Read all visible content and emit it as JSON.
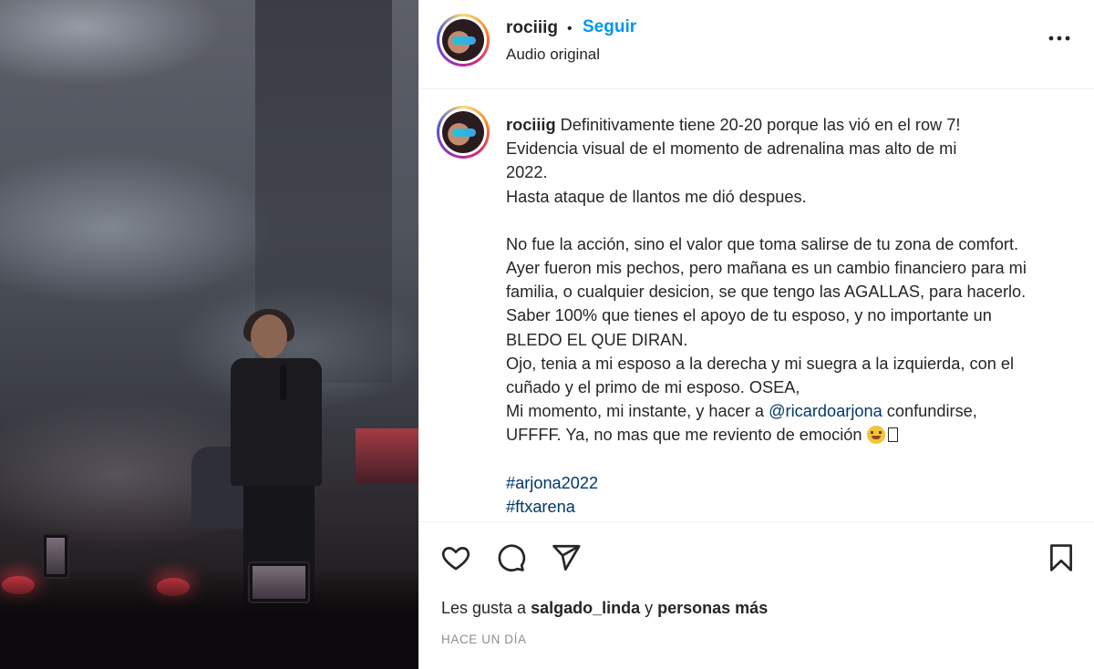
{
  "post": {
    "username": "rociiig",
    "dot": "•",
    "follow_label": "Seguir",
    "audio_label": "Audio original",
    "more_icon": "more-options-icon"
  },
  "caption": {
    "username": "rociiig",
    "line1": "Definitivamente tiene 20-20 porque las vió en el row 7!",
    "line2": "Evidencia visual de el momento de adrenalina mas alto de mi",
    "line3": "2022.",
    "line4": "Hasta ataque de llantos me dió despues.",
    "para2": "No fue la acción, sino el valor que toma salirse de tu zona de comfort. Ayer fueron mis pechos, pero mañana es un cambio financiero para mi familia, o cualquier desicion, se que tengo las AGALLAS, para hacerlo. Saber 100% que tienes el apoyo de tu esposo, y no importante un BLEDO EL QUE DIRAN.",
    "para3": "Ojo, tenia a mi esposo a la derecha y mi suegra a la izquierda, con el cuñado y el primo de mi esposo. OSEA,",
    "para4_pre": "Mi momento, mi instante, y hacer a ",
    "mention": "@ricardoarjona",
    "para4_post": " confundirse,",
    "para5": "UFFFF. Ya, no mas que me reviento de emoción ",
    "hashtag1": "#arjona2022",
    "hashtag2": "#ftxarena"
  },
  "actions": {
    "like_icon": "heart-icon",
    "comment_icon": "comment-icon",
    "share_icon": "share-icon",
    "save_icon": "bookmark-icon"
  },
  "likes": {
    "prefix": "Les gusta a ",
    "user": "salgado_linda",
    "middle": " y ",
    "suffix": "personas más"
  },
  "timestamp": "HACE UN DÍA",
  "colors": {
    "link": "#0095f6",
    "text": "#262626",
    "muted": "#8e8e8e",
    "hashtag": "#00376b"
  }
}
